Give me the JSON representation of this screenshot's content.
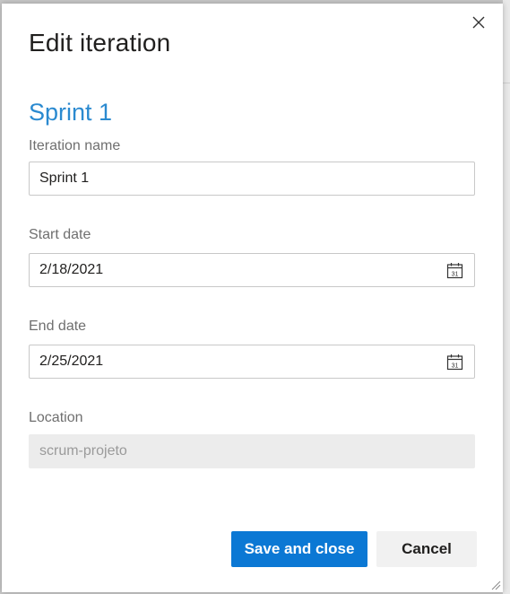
{
  "dialog": {
    "title": "Edit iteration",
    "close_icon": "close-icon"
  },
  "iteration": {
    "heading": "Sprint 1",
    "name_label": "Iteration name",
    "name_value": "Sprint 1",
    "start_label": "Start date",
    "start_value": "2/18/2021",
    "end_label": "End date",
    "end_value": "2/25/2021",
    "location_label": "Location",
    "location_value": "scrum-projeto",
    "calendar_icon": "calendar-icon",
    "calendar_day": "31"
  },
  "actions": {
    "save_label": "Save and close",
    "cancel_label": "Cancel"
  },
  "colors": {
    "accent": "#0b78d4",
    "heading": "#2b8ad0"
  }
}
